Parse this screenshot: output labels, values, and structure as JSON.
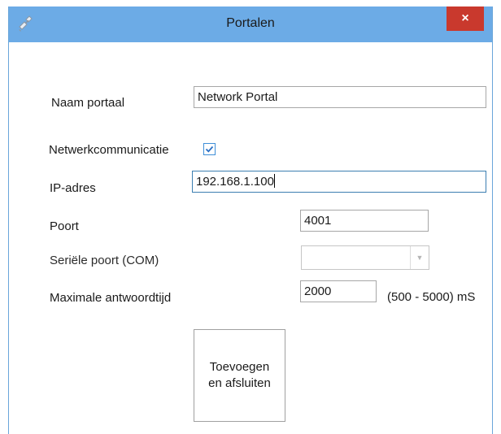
{
  "window": {
    "title": "Portalen",
    "close_label": "×"
  },
  "form": {
    "name_label": "Naam portaal",
    "name_value": "Network Portal",
    "network_label": "Netwerkcommunicatie",
    "network_checked": true,
    "ip_label": "IP-adres",
    "ip_value": "192.168.1.100",
    "port_label": "Poort",
    "port_value": "4001",
    "serial_label": "Seriële poort (COM)",
    "serial_value": "",
    "timeout_label": "Maximale antwoordtijd",
    "timeout_value": "2000",
    "timeout_range": "(500 - 5000) mS"
  },
  "buttons": {
    "add_line1": "Toevoegen",
    "add_line2": "en afsluiten"
  },
  "icons": {
    "title_icon": "satellite-icon",
    "close": "close-icon",
    "checkbox": "check-icon",
    "dropdown": "chevron-down-icon"
  },
  "colors": {
    "titlebar": "#6cabe6",
    "close_button": "#c9392d",
    "checkbox_border": "#3f8fd8"
  }
}
